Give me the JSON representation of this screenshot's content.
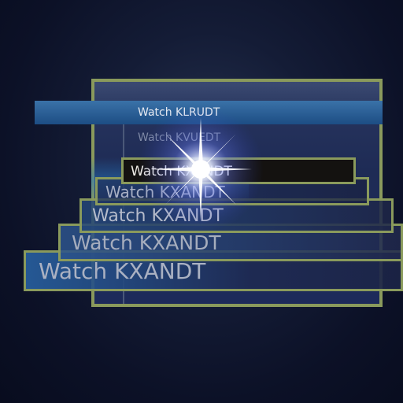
{
  "menu": {
    "items": [
      {
        "label": "Watch KLRUDT"
      },
      {
        "label": "Watch KVUEDT"
      }
    ],
    "transition_frames": [
      {
        "label": "Watch KXANDT"
      },
      {
        "label": "Watch KXANDT"
      },
      {
        "label": "Watch KXANDT"
      },
      {
        "label": "Watch KXANDT"
      },
      {
        "label": "Watch KXANDT"
      }
    ]
  },
  "colors": {
    "focus_border": "#8a9a5c",
    "highlight": "#2b63a0",
    "background": "#0c1127"
  }
}
